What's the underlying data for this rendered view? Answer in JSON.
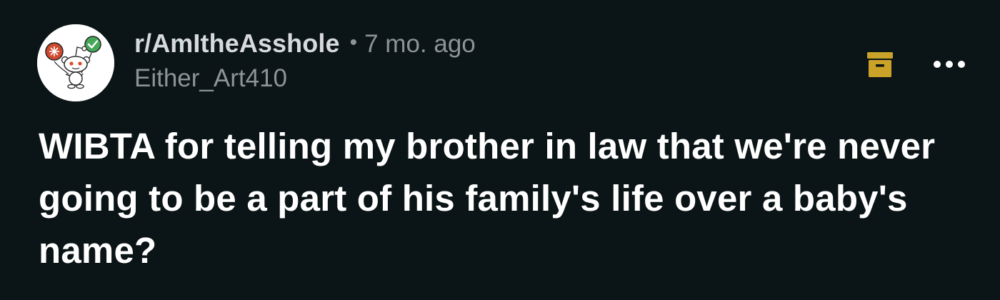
{
  "post": {
    "subreddit": "r/AmItheAsshole",
    "separator": "•",
    "age": "7 mo. ago",
    "author": "Either_Art410",
    "title": "WIBTA for telling my brother in law that we're never going to be a part of his family's life over a baby's name?"
  },
  "icons": {
    "avatar": "subreddit-snoo-avatar",
    "archive": "archive-box-icon",
    "more": "more-options-icon"
  },
  "colors": {
    "background": "#0b1416",
    "title_text": "#ffffff",
    "meta_text": "#8d9396",
    "subreddit_text": "#d7dadc",
    "archive_accent": "#c9a227",
    "avatar_accept": "#46a758",
    "avatar_reject": "#d04a2e"
  }
}
